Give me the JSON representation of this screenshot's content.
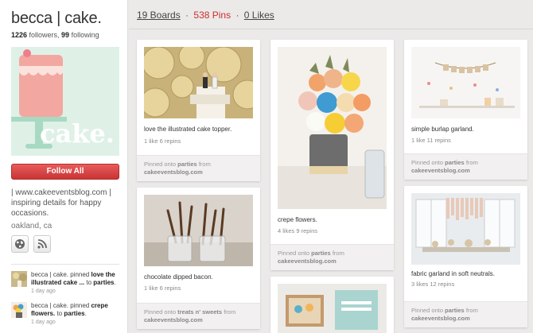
{
  "profile": {
    "name": "becca | cake.",
    "followers": "1226",
    "followers_label": " followers, ",
    "following": "99",
    "following_label": " following",
    "cover_text": "cake.",
    "follow_all": "Follow All",
    "bio": "| www.cakeeventsblog.com | inspiring details for happy occasions.",
    "location": "oakland, ca"
  },
  "activity": [
    {
      "actor": "becca | cake.",
      "verb": " pinned ",
      "item": "love the illustrated cake ...",
      "to": " to ",
      "board": "parties",
      "end": ".",
      "time": "1 day ago"
    },
    {
      "actor": "becca | cake.",
      "verb": " pinned ",
      "item": "crepe flowers.",
      "to": " to ",
      "board": "parties",
      "end": ".",
      "time": "1 day ago"
    }
  ],
  "tabs": {
    "boards": "19 Boards",
    "pins": "538 Pins",
    "likes": "0 Likes",
    "sep": "·"
  },
  "pins": [
    {
      "desc": "love the illustrated cake topper.",
      "stats": "1 like  6 repins",
      "pinned_onto": "Pinned onto ",
      "board": "parties",
      "from": " from",
      "source": "cakeeventsblog.com"
    },
    {
      "desc": "chocolate dipped bacon.",
      "stats": "1 like  6 repins",
      "pinned_onto": "Pinned onto ",
      "board": "treats n' sweets",
      "from": " from",
      "source": "cakeeventsblog.com"
    },
    {
      "desc": "crepe flowers.",
      "stats": "4 likes  9 repins",
      "pinned_onto": "Pinned onto ",
      "board": "parties",
      "from": " from",
      "source": "cakeeventsblog.com"
    },
    {
      "desc": "simple burlap garland.",
      "stats": "1 like  11 repins",
      "pinned_onto": "Pinned onto ",
      "board": "parties",
      "from": " from",
      "source": "cakeeventsblog.com"
    },
    {
      "desc": "fabric garland in soft neutrals.",
      "stats": "3 likes  12 repins",
      "pinned_onto": "Pinned onto ",
      "board": "parties",
      "from": " from",
      "source": "cakeeventsblog.com"
    }
  ],
  "icons": {
    "globe": "globe-icon",
    "rss": "rss-icon"
  },
  "colors": {
    "accent": "#c9302c",
    "follow_button": "#d94444",
    "cover_bg": "#def0e6"
  }
}
